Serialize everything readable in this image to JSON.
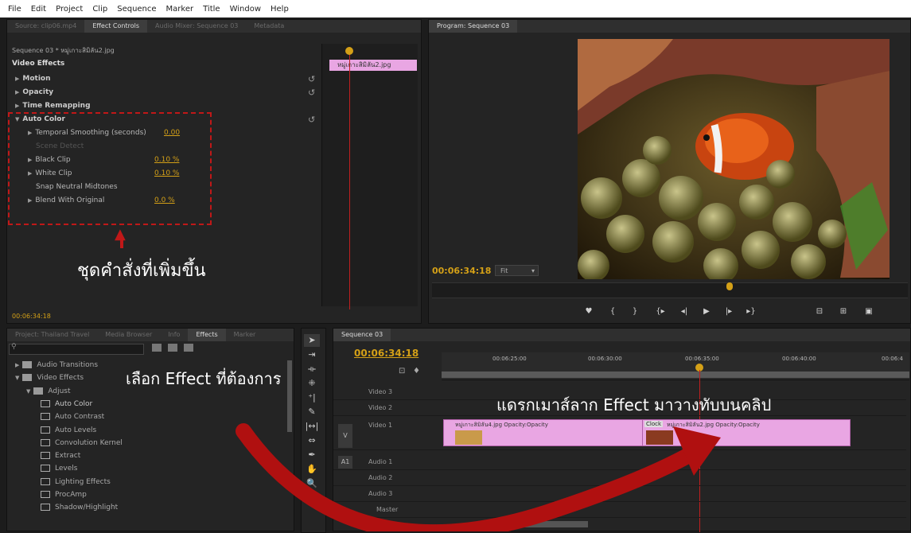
{
  "menu": [
    "File",
    "Edit",
    "Project",
    "Clip",
    "Sequence",
    "Marker",
    "Title",
    "Window",
    "Help"
  ],
  "source_tabs": [
    "Source: clip06.mp4",
    "Effect Controls",
    "Audio Mixer: Sequence 03",
    "Metadata"
  ],
  "effect_controls": {
    "sequence_path": "Sequence 03 * หมู่เกาะสิมิลัน2.jpg",
    "header": "Video Effects",
    "clip_label": "หมู่เกาะสิมิลัน2.jpg",
    "rows": [
      {
        "name": "Motion",
        "value": ""
      },
      {
        "name": "Opacity",
        "value": ""
      },
      {
        "name": "Time Remapping",
        "value": ""
      },
      {
        "name": "Auto Color",
        "value": ""
      },
      {
        "name": "Temporal Smoothing (seconds)",
        "value": "0.00"
      },
      {
        "name": "Scene Detect",
        "value": ""
      },
      {
        "name": "Black Clip",
        "value": "0.10 %"
      },
      {
        "name": "White Clip",
        "value": "0.10 %"
      },
      {
        "name": "Snap Neutral Midtones",
        "value": ""
      },
      {
        "name": "Blend With Original",
        "value": "0.0 %"
      }
    ],
    "timecode": "00:06:34:18"
  },
  "annotations": {
    "added_commands": "ชุดคำสั่งที่เพิ่มขึ้น",
    "select_effect": "เลือก Effect ที่ต้องการ",
    "drag_effect": "แดรกเมาส์ลาก Effect มาวางทับบนคลิป"
  },
  "program": {
    "tab": "Program: Sequence 03",
    "timecode": "00:06:34:18",
    "fit": "Fit"
  },
  "project_tabs": [
    "Project: Thailand Travel",
    "Media Browser",
    "Info",
    "Effects",
    "Marker"
  ],
  "effects_list": [
    {
      "label": "Audio Transitions",
      "level": 0,
      "folder": true
    },
    {
      "label": "Video Effects",
      "level": 0,
      "folder": true
    },
    {
      "label": "Adjust",
      "level": 1,
      "folder": true
    },
    {
      "label": "Auto Color",
      "level": 2,
      "folder": false
    },
    {
      "label": "Auto Contrast",
      "level": 2,
      "folder": false
    },
    {
      "label": "Auto Levels",
      "level": 2,
      "folder": false
    },
    {
      "label": "Convolution Kernel",
      "level": 2,
      "folder": false
    },
    {
      "label": "Extract",
      "level": 2,
      "folder": false
    },
    {
      "label": "Levels",
      "level": 2,
      "folder": false
    },
    {
      "label": "Lighting Effects",
      "level": 2,
      "folder": false
    },
    {
      "label": "ProcAmp",
      "level": 2,
      "folder": false
    },
    {
      "label": "Shadow/Highlight",
      "level": 2,
      "folder": false
    }
  ],
  "sequence": {
    "tab": "Sequence 03",
    "timecode": "00:06:34:18",
    "ruler": [
      "00:06:25:00",
      "00:06:30:00",
      "00:06:35:00",
      "00:06:40:00",
      "00:06:4"
    ],
    "tracks": [
      "Video 3",
      "Video 2",
      "Video 1",
      "Audio 1",
      "Audio 2",
      "Audio 3",
      "Master"
    ],
    "v_label": "V",
    "a_label": "A1",
    "clip1": "หมู่เกาะสิมิลัน4.jpg  Opacity:Opacity",
    "clip2_prefix": "Clock",
    "clip2": "หมู่เกาะสิมิลัน2.jpg  Opacity:Opacity"
  },
  "colors": {
    "accent": "#d4a017",
    "clip": "#e9a6e3",
    "arrow": "#b01010"
  }
}
